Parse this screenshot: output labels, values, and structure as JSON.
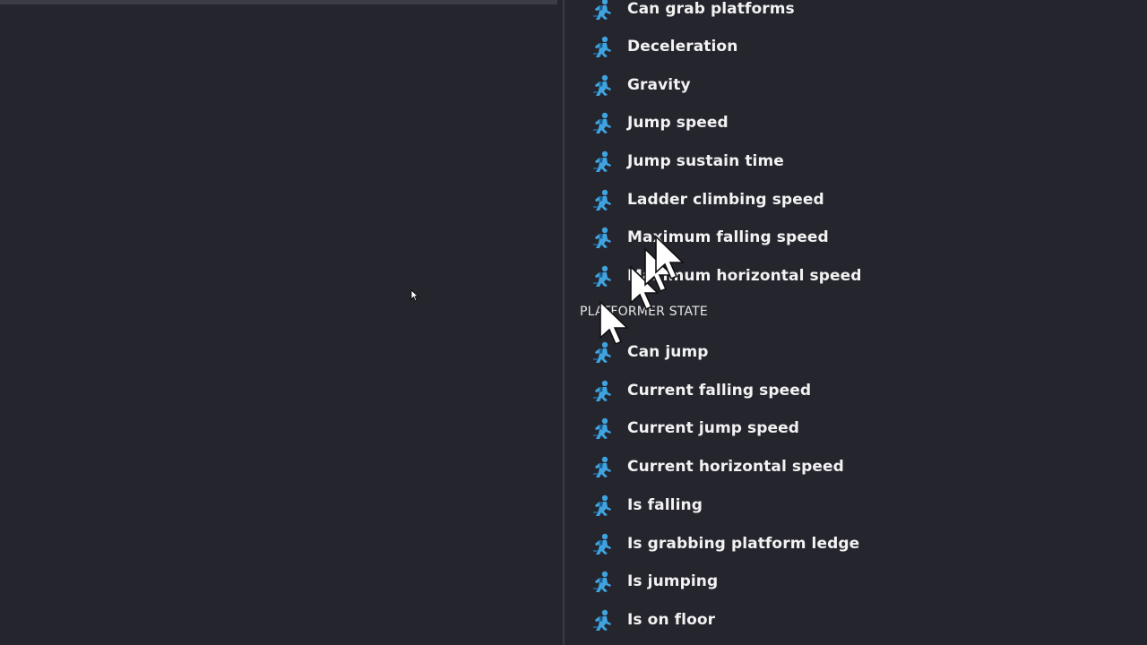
{
  "colors": {
    "background": "#25252e",
    "divider": "#3a3a42",
    "icon_blue": "#3fa3e0",
    "icon_dark": "#1d5f8c",
    "text": "#f2f2f2"
  },
  "icon_name": "platformer-character-icon",
  "properties_list": {
    "top_items": [
      {
        "label": "Can grab platforms"
      },
      {
        "label": "Deceleration"
      },
      {
        "label": "Gravity"
      },
      {
        "label": "Jump speed"
      },
      {
        "label": "Jump sustain time"
      },
      {
        "label": "Ladder climbing speed"
      },
      {
        "label": "Maximum falling speed"
      },
      {
        "label": "Maximum horizontal speed"
      }
    ],
    "section_header": "PLATFORMER STATE",
    "state_items": [
      {
        "label": "Can jump"
      },
      {
        "label": "Current falling speed"
      },
      {
        "label": "Current jump speed"
      },
      {
        "label": "Current horizontal speed"
      },
      {
        "label": "Is falling"
      },
      {
        "label": "Is grabbing platform ledge"
      },
      {
        "label": "Is jumping"
      },
      {
        "label": "Is on floor"
      }
    ]
  }
}
